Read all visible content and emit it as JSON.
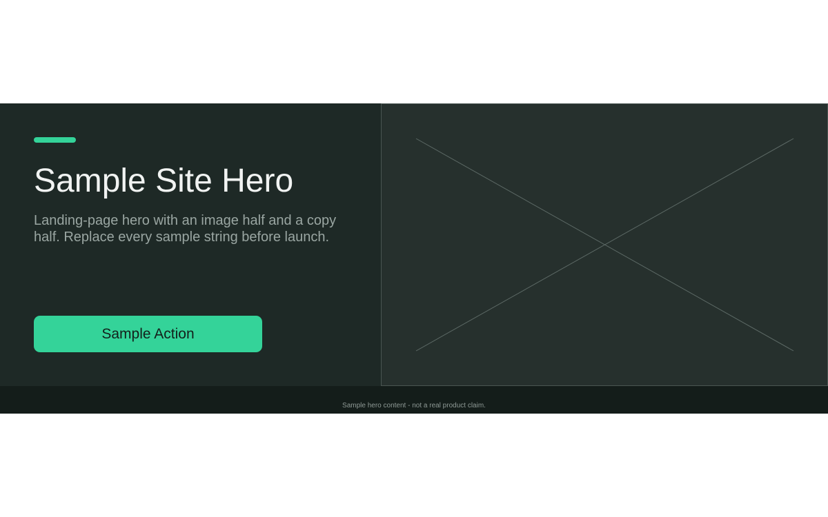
{
  "hero": {
    "title": "Sample Site Hero",
    "subtitle": "Landing-page hero with an image half and a copy half. Replace every sample string before launch.",
    "cta_label": "Sample Action",
    "accent_color": "#34d399",
    "background_color": "#1e2926",
    "image_placeholder_icon": "image-placeholder-cross-icon"
  },
  "footer": {
    "note": "Sample hero content - not a real product claim."
  }
}
